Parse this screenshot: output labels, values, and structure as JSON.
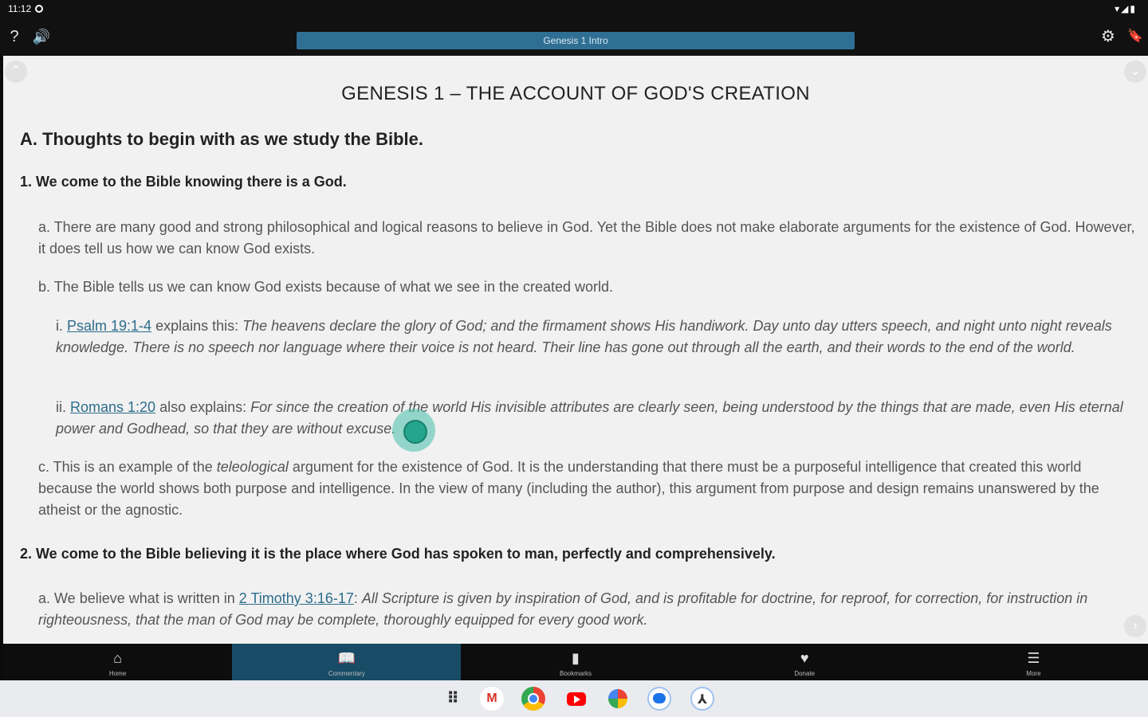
{
  "status_bar": {
    "time": "11:12",
    "system_icons": "▾◢▮"
  },
  "toolbar": {
    "help_icon": "?",
    "audio_icon": "🔊",
    "title": "Genesis 1 Intro",
    "settings_icon": "⚙",
    "bookmark_icon": "🔖"
  },
  "content": {
    "title": "GENESIS 1 – THE ACCOUNT OF GOD'S CREATION",
    "section_a": "A. Thoughts to begin with as we study the Bible.",
    "point1": "1. We come to the Bible knowing there is a God.",
    "p1a": "a. There are many good and strong philosophical and logical reasons to believe in God. Yet the Bible does not make elaborate arguments for the existence of God. However, it does tell us how we can know God exists.",
    "p1b": "b. The Bible tells us we can know God exists because of what we see in the created world.",
    "p1bi_prefix": "i. ",
    "p1bi_link": "Psalm 19:1-4",
    "p1bi_mid": " explains this: ",
    "p1bi_quote": "The heavens declare the glory of God; and the firmament shows His handiwork. Day unto day utters speech, and night unto night reveals knowledge. There is no speech nor language where their voice is not heard. Their line has gone out through all the earth, and their words to the end of the world.",
    "p1bii_prefix": "ii. ",
    "p1bii_link": "Romans 1:20",
    "p1bii_mid": " also explains: ",
    "p1bii_quote": "For since the creation of the world His invisible attributes are clearly seen, being understood by the things that are made, even His eternal power and Godhead, so that they are without excuse.",
    "p1c_pre": "c. This is an example of the ",
    "p1c_em": "teleological",
    "p1c_post": " argument for the existence of God. It is the understanding that there must be a purposeful intelligence that created this world because the world shows both purpose and intelligence. In the view of many (including the author), this argument from purpose and design remains unanswered by the atheist or the agnostic.",
    "point2": "2. We come to the Bible believing it is the place where God has spoken to man, perfectly and comprehensively.",
    "p2a_pre": "a. We believe what is written in ",
    "p2a_link": "2 Timothy 3:16-17",
    "p2a_mid": ": ",
    "p2a_quote": "All Scripture is given by inspiration of God, and is profitable for doctrine, for reproof, for correction, for instruction in righteousness, that the man of God may be complete, thoroughly equipped for every good work."
  },
  "bottom_nav": [
    {
      "label": "Home",
      "icon": "⌂"
    },
    {
      "label": "Commentary",
      "icon": "📖"
    },
    {
      "label": "Bookmarks",
      "icon": "▮"
    },
    {
      "label": "Donate",
      "icon": "♥"
    },
    {
      "label": "More",
      "icon": "☰"
    }
  ],
  "taskbar": {
    "launcher_icon": "⠿",
    "gmail_icon": "M"
  }
}
